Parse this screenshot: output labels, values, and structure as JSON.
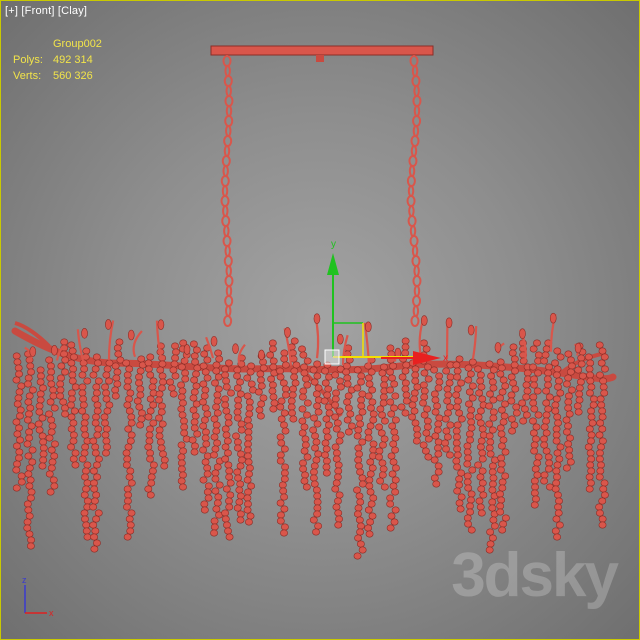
{
  "viewport": {
    "label_parts": [
      "[+]",
      "[Front]",
      "[Clay]"
    ],
    "object_name": "Group002",
    "stats": [
      {
        "label": "Polys:",
        "value": "492 314"
      },
      {
        "label": "Verts:",
        "value": "560 326"
      }
    ],
    "gizmo_axis_labels": {
      "y": "y",
      "x": "x"
    },
    "tripod_axis_labels": {
      "z": "z",
      "x": "x"
    },
    "watermark": "3dsky"
  },
  "colors": {
    "model": "#d9564b",
    "model_dark": "#8a2d27",
    "gizmo_y": "#1fc21f",
    "gizmo_x": "#e82020",
    "gizmo_plane": "#f5e000",
    "frame": "#c9c900"
  }
}
